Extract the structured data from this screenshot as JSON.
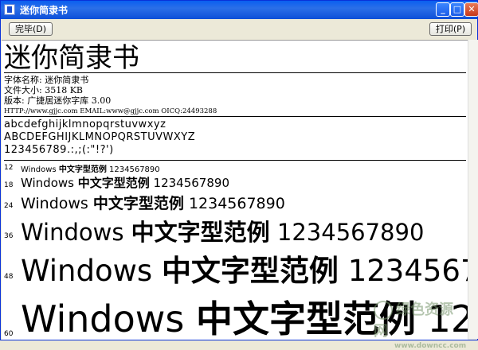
{
  "window": {
    "title": "迷你简隶书"
  },
  "toolbar": {
    "done_label": "完毕(D)",
    "print_label": "打印(P)"
  },
  "preview": {
    "font_title": "迷你简隶书",
    "info_lines": [
      "字体名称: 迷你简隶书",
      "文件大小: 3518 KB",
      "版本: 广捷居迷你字库 3.00"
    ],
    "contact_line": "HTTP://www.gjjc.com  EMAIL:www@gjjc.com  OICQ:24493288",
    "lowercase": "abcdefghijklmnopqrstuvwxyz",
    "uppercase": "ABCDEFGHIJKLMNOPQRSTUVWXYZ",
    "digits": "123456789.:,;(:\"!?')",
    "sample_latin": "Windows",
    "sample_cjk": "中文字型范例",
    "sample_digits": "1234567890",
    "sizes": [
      "12",
      "18",
      "24",
      "36",
      "48",
      "60"
    ]
  },
  "watermark": {
    "text": "绿色资源网",
    "url": "www.downcc.com"
  }
}
